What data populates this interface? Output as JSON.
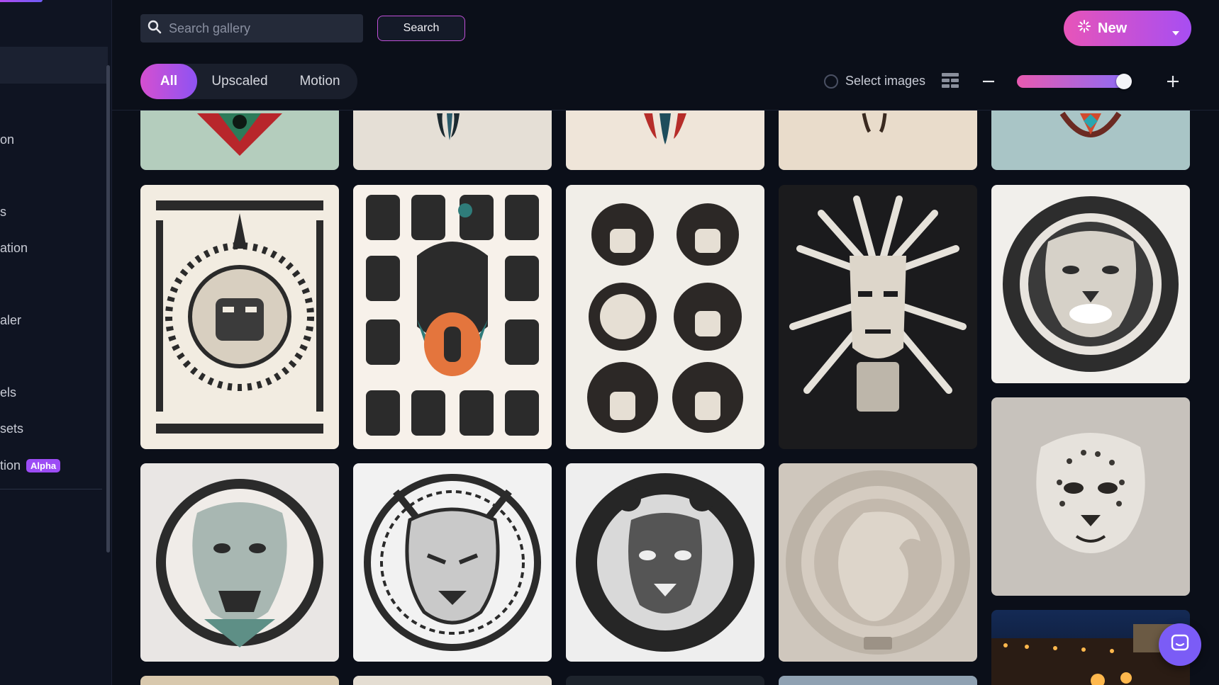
{
  "sidebar": {
    "items": [
      {
        "label": "on"
      },
      {
        "label": "s"
      },
      {
        "label": "ation"
      },
      {
        "label": "aler"
      },
      {
        "label": "els"
      },
      {
        "label": "sets"
      },
      {
        "label": "tion",
        "badge": "Alpha"
      }
    ]
  },
  "header": {
    "search_placeholder": "Search gallery",
    "search_button": "Search",
    "new_button": "New"
  },
  "filters": {
    "tabs": [
      {
        "label": "All",
        "active": true
      },
      {
        "label": "Upscaled",
        "active": false
      },
      {
        "label": "Motion",
        "active": false
      }
    ],
    "select_images_label": "Select images"
  },
  "colors": {
    "accent_start": "#e754b9",
    "accent_end": "#a74ef2",
    "background": "#0b0f19"
  },
  "icons": [
    "search-icon",
    "sparkle-icon",
    "chevron-down-icon",
    "grid-layout-icon",
    "minus-icon",
    "plus-icon",
    "chat-icon"
  ],
  "zoom_slider_level": 1.0
}
